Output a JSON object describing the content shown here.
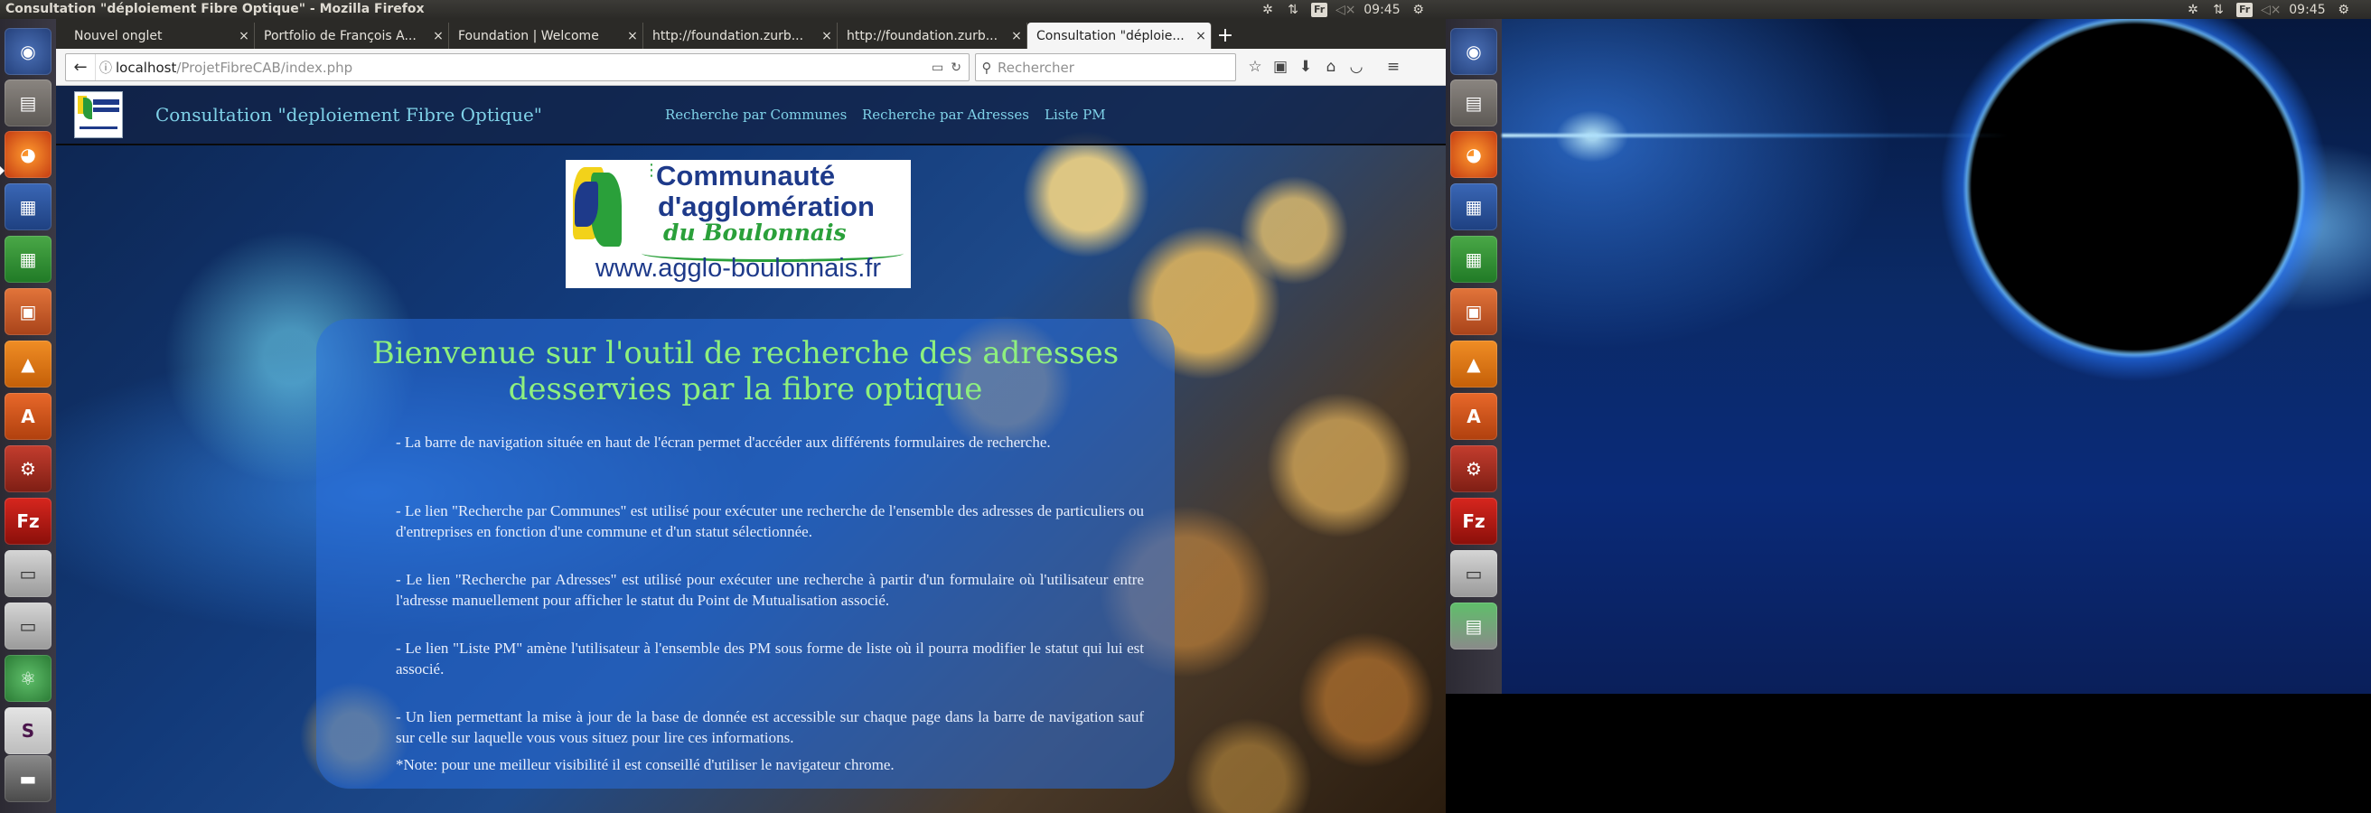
{
  "left_topbar": {
    "window_title": "Consultation \"déploiement Fibre Optique\" - Mozilla Firefox",
    "keyboard_layout": "Fr",
    "clock": "09:45"
  },
  "right_topbar": {
    "keyboard_layout": "Fr",
    "clock": "09:45"
  },
  "launcher_apps": [
    "ubuntu-logo-icon",
    "files-icon",
    "firefox-icon",
    "writer-icon",
    "calc-icon",
    "impress-icon",
    "vlc-icon",
    "software-center-icon",
    "system-settings-icon",
    "filezilla-icon",
    "drive-icon",
    "drive-icon",
    "atom-icon",
    "slack-icon",
    "trash-icon"
  ],
  "tabs": [
    {
      "label": "Nouvel onglet"
    },
    {
      "label": "Portfolio de François A..."
    },
    {
      "label": "Foundation | Welcome"
    },
    {
      "label": "http://foundation.zurb..."
    },
    {
      "label": "http://foundation.zurb..."
    },
    {
      "label": "Consultation \"déploie..."
    }
  ],
  "urlbar": {
    "host": "localhost",
    "path": "/ProjetFibreCAB/index.php"
  },
  "searchbar": {
    "placeholder": "Rechercher"
  },
  "site": {
    "title": "Consultation \"deploiement Fibre Optique\"",
    "nav": [
      "Recherche par Communes",
      "Recherche par Adresses",
      "Liste PM"
    ],
    "logo": {
      "line1": "Communauté",
      "line2": "d'agglomération",
      "line3": "du Boulonnais",
      "url": "www.agglo-boulonnais.fr"
    },
    "welcome_title": "Bienvenue sur l'outil de recherche des adresses desservies par la fibre optique",
    "paragraphs": [
      "- La barre de navigation située en haut de l'écran permet d'accéder aux différents formulaires de recherche.",
      "- Le lien \"Recherche par Communes\" est utilisé pour exécuter une recherche de l'ensemble des adresses de particuliers ou d'entreprises en fonction d'une commune et d'un statut sélectionnée.",
      "- Le lien \"Recherche par Adresses\" est utilisé pour exécuter une recherche à partir d'un formulaire où l'utilisateur entre l'adresse manuellement pour afficher le statut du Point de Mutualisation associé.",
      "- Le lien \"Liste PM\" amène l'utilisateur à l'ensemble des PM sous forme de liste où il pourra modifier le statut qui lui est associé.",
      "- Un lien permettant la mise à jour de la base de donnée est accessible sur chaque page dans la barre de navigation sauf sur celle sur laquelle vous vous situez pour lire ces informations.",
      "*Note: pour une meilleur visibilité il est conseillé d'utiliser le navigateur chrome."
    ]
  }
}
